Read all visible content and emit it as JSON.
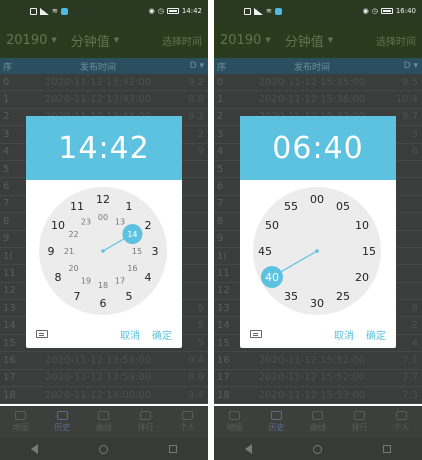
{
  "theme": {
    "accent": "#5cc2e0"
  },
  "statusbar": {
    "icons": [
      "sim-icon",
      "signal-icon",
      "wifi-icon",
      "app-icon"
    ],
    "right_icons": [
      "eye-icon",
      "clock-icon"
    ],
    "left_time": "14:42",
    "right_time": "16:40"
  },
  "appbar": {
    "year": "20190",
    "unit": "分钟值",
    "pick_time": "选择时间"
  },
  "table": {
    "headers": [
      "序",
      "发布时间",
      "D"
    ],
    "left_rows": [
      [
        "0",
        "2020-11-12 13:42:00",
        "9.2"
      ],
      [
        "1",
        "2020-11-12 13:43:00",
        "8.8"
      ],
      [
        "2",
        "2020-11-12 13:44:00",
        "9.2"
      ],
      [
        "3",
        "",
        "2"
      ],
      [
        "4",
        "",
        "9"
      ],
      [
        "5",
        "",
        ""
      ],
      [
        "6",
        "",
        ""
      ],
      [
        "7",
        "",
        ""
      ],
      [
        "8",
        "",
        ""
      ],
      [
        "9",
        "",
        ""
      ],
      [
        "1(",
        "",
        ""
      ],
      [
        "11",
        "",
        ""
      ],
      [
        "12",
        "",
        ""
      ],
      [
        "13",
        "",
        "5"
      ],
      [
        "14",
        "",
        "5"
      ],
      [
        "15",
        "",
        "5"
      ],
      [
        "16",
        "2020-11-12 13:58:00",
        "9.4"
      ],
      [
        "17",
        "2020-11-12 13:59:00",
        "8.9"
      ],
      [
        "18",
        "2020-11-12 14:00:00",
        "9.4"
      ]
    ],
    "right_rows": [
      [
        "0",
        "2020-11-12 15:35:00",
        "9.5"
      ],
      [
        "1",
        "2020-11-12 15:36:00",
        "10.4"
      ],
      [
        "2",
        "2020-11-12 15:37:00",
        "8.7"
      ],
      [
        "3",
        "",
        "3"
      ],
      [
        "4",
        "",
        "6"
      ],
      [
        "5",
        "",
        ""
      ],
      [
        "6",
        "",
        ""
      ],
      [
        "7",
        "",
        ""
      ],
      [
        "8",
        "",
        ""
      ],
      [
        "9",
        "",
        ""
      ],
      [
        "1(",
        "",
        ""
      ],
      [
        "11",
        "",
        ""
      ],
      [
        "12",
        "",
        ""
      ],
      [
        "13",
        "",
        "8"
      ],
      [
        "14",
        "",
        "2"
      ],
      [
        "15",
        "",
        "4"
      ],
      [
        "16",
        "2020-11-12 15:51:00",
        "7.1"
      ],
      [
        "17",
        "2020-11-12 15:52:00",
        "7.7"
      ],
      [
        "18",
        "2020-11-12 15:53:00",
        "7.3"
      ]
    ]
  },
  "tabs": [
    {
      "label": "地图",
      "icon": "map-icon"
    },
    {
      "label": "历史",
      "icon": "history-icon"
    },
    {
      "label": "曲线",
      "icon": "chart-icon"
    },
    {
      "label": "排行",
      "icon": "ranking-icon"
    },
    {
      "label": "个人",
      "icon": "person-icon"
    }
  ],
  "dialog_left": {
    "time": "14:42",
    "mode": "hours",
    "outer": [
      "12",
      "1",
      "2",
      "3",
      "4",
      "5",
      "6",
      "7",
      "8",
      "9",
      "10",
      "11"
    ],
    "inner": [
      "00",
      "13",
      "14",
      "15",
      "16",
      "17",
      "18",
      "19",
      "20",
      "21",
      "22",
      "23"
    ],
    "selected": "14",
    "cancel": "取消",
    "ok": "确定"
  },
  "dialog_right": {
    "time": "06:40",
    "mode": "minutes",
    "outer": [
      "00",
      "05",
      "10",
      "15",
      "20",
      "25",
      "30",
      "35",
      "40",
      "45",
      "50",
      "55"
    ],
    "selected": "40",
    "cancel": "取消",
    "ok": "确定"
  }
}
